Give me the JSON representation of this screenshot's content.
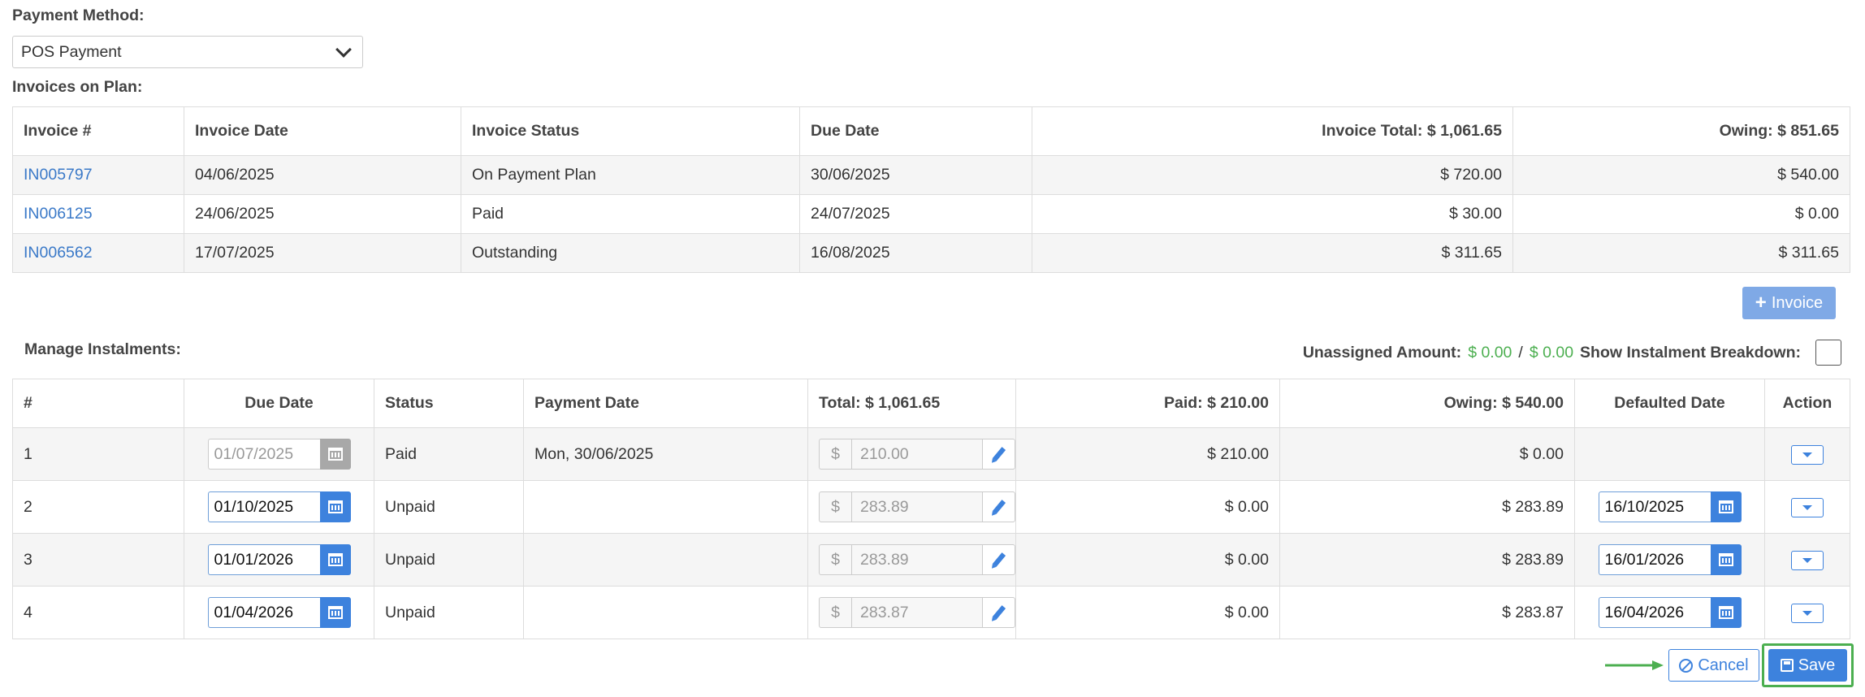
{
  "payment_method": {
    "label": "Payment Method:",
    "selected": "POS Payment"
  },
  "invoices": {
    "label": "Invoices on Plan:",
    "headers": [
      "Invoice #",
      "Invoice Date",
      "Invoice Status",
      "Due Date",
      "Invoice Total: $ 1,061.65",
      "Owing: $ 851.65"
    ],
    "rows": [
      [
        "IN005797",
        "04/06/2025",
        "On Payment Plan",
        "30/06/2025",
        "$ 720.00",
        "$ 540.00"
      ],
      [
        "IN006125",
        "24/06/2025",
        "Paid",
        "24/07/2025",
        "$ 30.00",
        "$ 0.00"
      ],
      [
        "IN006562",
        "17/07/2025",
        "Outstanding",
        "16/08/2025",
        "$ 311.65",
        "$ 311.65"
      ]
    ],
    "add_button": "Invoice"
  },
  "instalments": {
    "label": "Manage Instalments:",
    "unassigned_label": "Unassigned Amount:",
    "unassigned_value": "$ 0.00",
    "unassigned_sep": "/",
    "unassigned_total": "$ 0.00",
    "breakdown_label": "Show Instalment Breakdown:",
    "headers": [
      "#",
      "Due Date",
      "Status",
      "Payment Date",
      "Total: $ 1,061.65",
      "Paid: $ 210.00",
      "Owing: $ 540.00",
      "Defaulted Date",
      "Action"
    ],
    "currency_prefix": "$",
    "rows": [
      {
        "num": "1",
        "due": "01/07/2025",
        "status": "Paid",
        "payment_date": "Mon, 30/06/2025",
        "total": "210.00",
        "paid": "$ 210.00",
        "owing": "$ 0.00",
        "defaulted": ""
      },
      {
        "num": "2",
        "due": "01/10/2025",
        "status": "Unpaid",
        "payment_date": "",
        "total": "283.89",
        "paid": "$ 0.00",
        "owing": "$ 283.89",
        "defaulted": "16/10/2025"
      },
      {
        "num": "3",
        "due": "01/01/2026",
        "status": "Unpaid",
        "payment_date": "",
        "total": "283.89",
        "paid": "$ 0.00",
        "owing": "$ 283.89",
        "defaulted": "16/01/2026"
      },
      {
        "num": "4",
        "due": "01/04/2026",
        "status": "Unpaid",
        "payment_date": "",
        "total": "283.87",
        "paid": "$ 0.00",
        "owing": "$ 283.87",
        "defaulted": "16/04/2026"
      }
    ]
  },
  "footer": {
    "cancel": "Cancel",
    "save": "Save"
  },
  "colors": {
    "accent": "#3d82dd",
    "success": "#4caf50",
    "link": "#3a79c8"
  }
}
